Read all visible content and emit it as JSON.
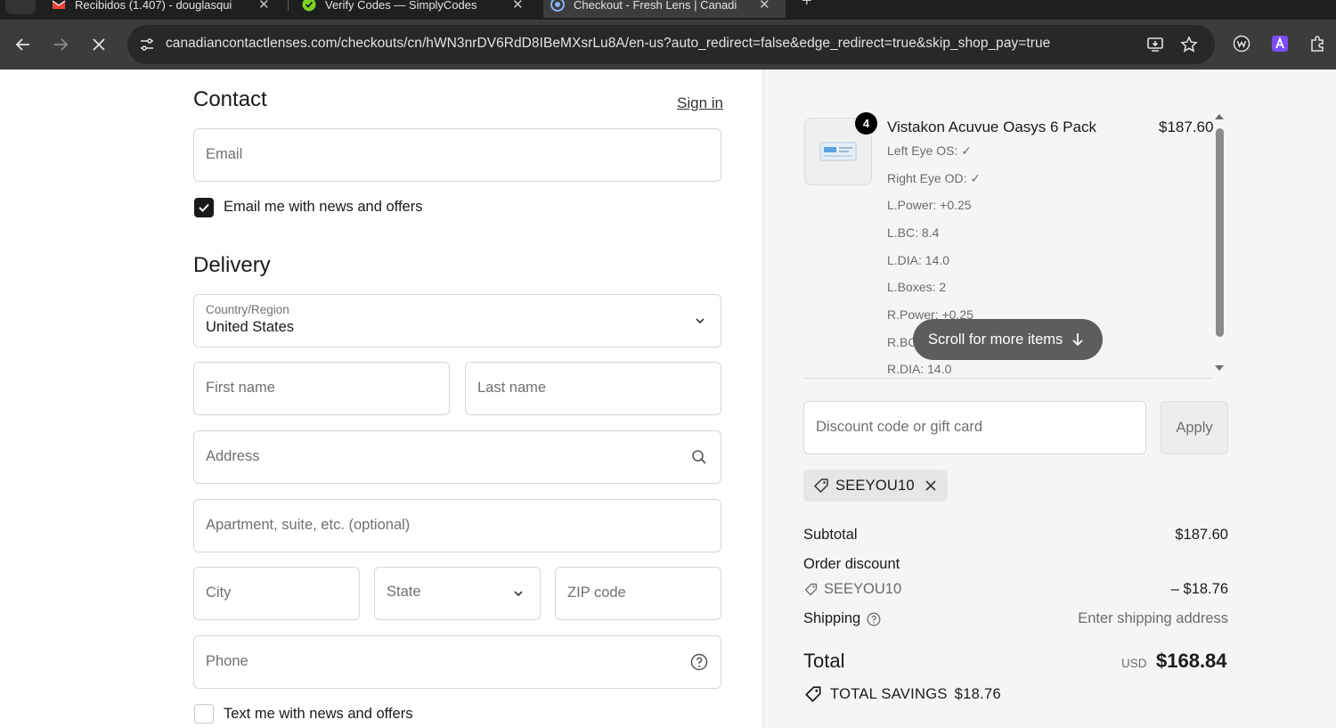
{
  "browser": {
    "tabs": [
      {
        "title": "Recibidos (1.407) - douglasqui",
        "active": false
      },
      {
        "title": "Verify Codes — SimplyCodes",
        "active": false
      },
      {
        "title": "Checkout - Fresh Lens | Canadi",
        "active": true
      }
    ],
    "new_tab_label": "+",
    "url": "canadiancontactlenses.com/checkouts/cn/hWN3nrDV6RdD8IBeMXsrLu8A/en-us?auto_redirect=false&edge_redirect=true&skip_shop_pay=true"
  },
  "contact": {
    "heading": "Contact",
    "sign_in": "Sign in",
    "email_placeholder": "Email",
    "news_checkbox_label": "Email me with news and offers",
    "news_checked": true
  },
  "delivery": {
    "heading": "Delivery",
    "country_label": "Country/Region",
    "country_value": "United States",
    "first_name_placeholder": "First name",
    "last_name_placeholder": "Last name",
    "address_placeholder": "Address",
    "apartment_placeholder": "Apartment, suite, etc. (optional)",
    "city_placeholder": "City",
    "state_placeholder": "State",
    "zip_placeholder": "ZIP code",
    "phone_placeholder": "Phone",
    "text_checkbox_label": "Text me with news and offers",
    "text_checked": false
  },
  "order": {
    "item": {
      "quantity": "4",
      "name": "Vistakon Acuvue Oasys 6 Pack",
      "price": "$187.60",
      "properties": [
        "Left Eye OS: ✓",
        "Right Eye OD: ✓",
        "L.Power: +0.25",
        "L.BC: 8.4",
        "L.DIA: 14.0",
        "L.Boxes: 2",
        "R.Power: +0.25",
        "R.BC: 8.4",
        "R.DIA: 14.0"
      ]
    },
    "scroll_hint": "Scroll for more items",
    "discount_placeholder": "Discount code or gift card",
    "apply_label": "Apply",
    "applied_code": "SEEYOU10",
    "subtotal_label": "Subtotal",
    "subtotal_value": "$187.60",
    "order_discount_label": "Order discount",
    "discount_code": "SEEYOU10",
    "discount_value": "– $18.76",
    "shipping_label": "Shipping",
    "shipping_value": "Enter shipping address",
    "total_label": "Total",
    "total_currency": "USD",
    "total_value": "$168.84",
    "savings_label": "TOTAL SAVINGS",
    "savings_value": "$18.76"
  }
}
